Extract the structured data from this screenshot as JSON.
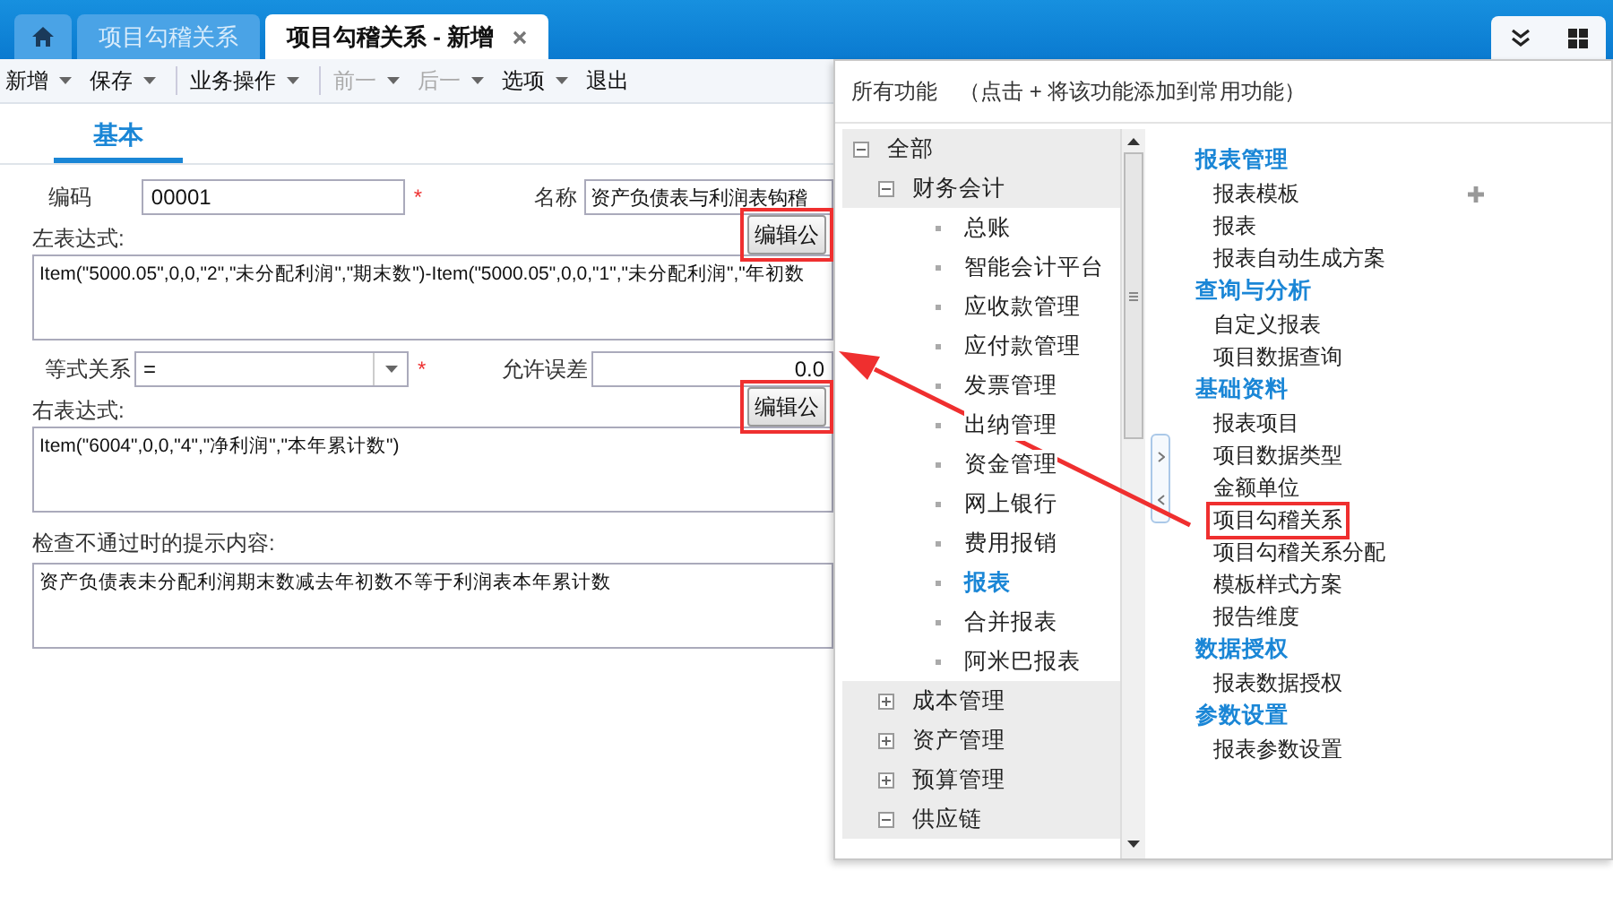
{
  "tabs": [
    {
      "kind": "home",
      "selected": false
    },
    {
      "kind": "page",
      "label": "项目勾稽关系",
      "selected": false,
      "closable": false
    },
    {
      "kind": "page",
      "label": "项目勾稽关系 - 新增",
      "selected": true,
      "closable": true
    }
  ],
  "toolbar": [
    {
      "kind": "menu",
      "label": "新增",
      "disabled": false
    },
    {
      "kind": "menu",
      "label": "保存",
      "disabled": false
    },
    {
      "kind": "separator"
    },
    {
      "kind": "menu",
      "label": "业务操作",
      "disabled": false
    },
    {
      "kind": "separator"
    },
    {
      "kind": "menu",
      "label": "前一",
      "disabled": true
    },
    {
      "kind": "menu",
      "label": "后一",
      "disabled": true
    },
    {
      "kind": "menu",
      "label": "选项",
      "disabled": false
    },
    {
      "kind": "button",
      "label": "退出",
      "disabled": false
    }
  ],
  "form": {
    "subtabs": [
      {
        "label": "基本",
        "selected": true
      }
    ],
    "code": {
      "label": "编码",
      "value": "00001",
      "required_mark": "*"
    },
    "name": {
      "label": "名称",
      "value": "资产负债表与利润表钩稽"
    },
    "left_expression": {
      "label": "左表达式:",
      "button": "编辑公",
      "highlighted": true,
      "value": "Item(\"5000.05\",0,0,\"2\",\"未分配利润\",\"期末数\")-Item(\"5000.05\",0,0,\"1\",\"未分配利润\",\"年初数"
    },
    "relation": {
      "label": "等式关系",
      "value": "=",
      "required_mark": "*"
    },
    "tolerance": {
      "label": "允许误差",
      "value": "0.0"
    },
    "right_expression": {
      "label": "右表达式:",
      "button": "编辑公",
      "highlighted": true,
      "value": "Item(\"6004\",0,0,\"4\",\"净利润\",\"本年累计数\")"
    },
    "message": {
      "label": "检查不通过时的提示内容:",
      "value": "资产负债表未分配利润期末数减去年初数不等于利润表本年累计数"
    }
  },
  "popup": {
    "title": "所有功能",
    "hint": "（点击 + 将该功能添加到常用功能）",
    "tree": [
      {
        "label": "全部",
        "expanded": true,
        "children": [
          {
            "label": "财务会计",
            "expanded": true,
            "children": [
              {
                "label": "总账",
                "selected": false
              },
              {
                "label": "智能会计平台",
                "selected": false
              },
              {
                "label": "应收款管理",
                "selected": false
              },
              {
                "label": "应付款管理",
                "selected": false
              },
              {
                "label": "发票管理",
                "selected": false
              },
              {
                "label": "出纳管理",
                "selected": false
              },
              {
                "label": "资金管理",
                "selected": false
              },
              {
                "label": "网上银行",
                "selected": false
              },
              {
                "label": "费用报销",
                "selected": false
              },
              {
                "label": "报表",
                "selected": true
              },
              {
                "label": "合并报表",
                "selected": false
              },
              {
                "label": "阿米巴报表",
                "selected": false
              }
            ]
          },
          {
            "label": "成本管理",
            "expanded": false
          },
          {
            "label": "资产管理",
            "expanded": false
          },
          {
            "label": "预算管理",
            "expanded": false
          },
          {
            "label": "供应链",
            "expanded": true
          }
        ]
      }
    ],
    "sections": [
      {
        "title": "报表管理",
        "items": [
          {
            "label": "报表模板",
            "addable": true,
            "highlighted": false
          },
          {
            "label": "报表",
            "addable": false,
            "highlighted": false
          },
          {
            "label": "报表自动生成方案",
            "addable": false,
            "highlighted": false
          }
        ]
      },
      {
        "title": "查询与分析",
        "items": [
          {
            "label": "自定义报表",
            "addable": false,
            "highlighted": false
          },
          {
            "label": "项目数据查询",
            "addable": false,
            "highlighted": false
          }
        ]
      },
      {
        "title": "基础资料",
        "items": [
          {
            "label": "报表项目",
            "addable": false,
            "highlighted": false
          },
          {
            "label": "项目数据类型",
            "addable": false,
            "highlighted": false
          },
          {
            "label": "金额单位",
            "addable": false,
            "highlighted": false
          },
          {
            "label": "项目勾稽关系",
            "addable": false,
            "highlighted": true
          },
          {
            "label": "项目勾稽关系分配",
            "addable": false,
            "highlighted": false
          },
          {
            "label": "模板样式方案",
            "addable": false,
            "highlighted": false
          },
          {
            "label": "报告维度",
            "addable": false,
            "highlighted": false
          }
        ]
      },
      {
        "title": "数据授权",
        "items": [
          {
            "label": "报表数据授权",
            "addable": false,
            "highlighted": false
          }
        ]
      },
      {
        "title": "参数设置",
        "items": [
          {
            "label": "报表参数设置",
            "addable": false,
            "highlighted": false
          }
        ]
      }
    ]
  }
}
